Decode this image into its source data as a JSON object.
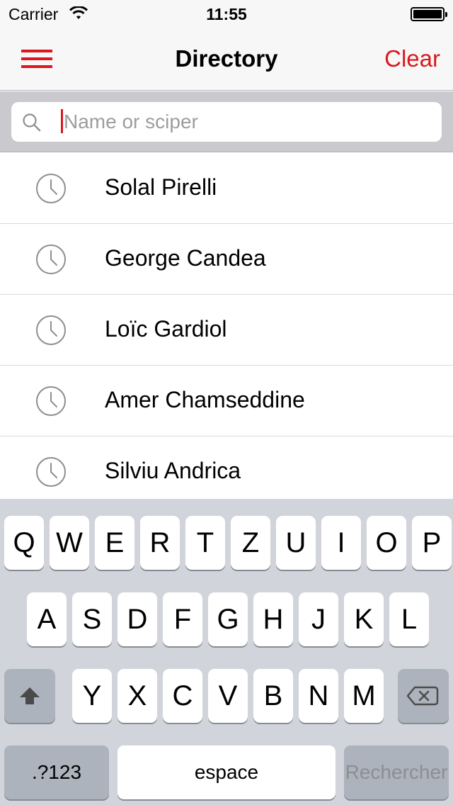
{
  "status_bar": {
    "carrier": "Carrier",
    "time": "11:55"
  },
  "nav": {
    "title": "Directory",
    "clear_label": "Clear"
  },
  "search": {
    "placeholder": "Name or sciper",
    "value": ""
  },
  "recent": [
    {
      "name": "Solal Pirelli"
    },
    {
      "name": "George Candea"
    },
    {
      "name": "Loïc Gardiol"
    },
    {
      "name": "Amer Chamseddine"
    },
    {
      "name": "Silviu Andrica"
    }
  ],
  "keyboard": {
    "row1": [
      "Q",
      "W",
      "E",
      "R",
      "T",
      "Z",
      "U",
      "I",
      "O",
      "P"
    ],
    "row2": [
      "A",
      "S",
      "D",
      "F",
      "G",
      "H",
      "J",
      "K",
      "L"
    ],
    "row3": [
      "Y",
      "X",
      "C",
      "V",
      "B",
      "N",
      "M"
    ],
    "numbers_label": ".?123",
    "space_label": "espace",
    "search_label": "Rechercher"
  },
  "colors": {
    "accent": "#d9181f",
    "keyboard_bg": "#d1d5db"
  }
}
